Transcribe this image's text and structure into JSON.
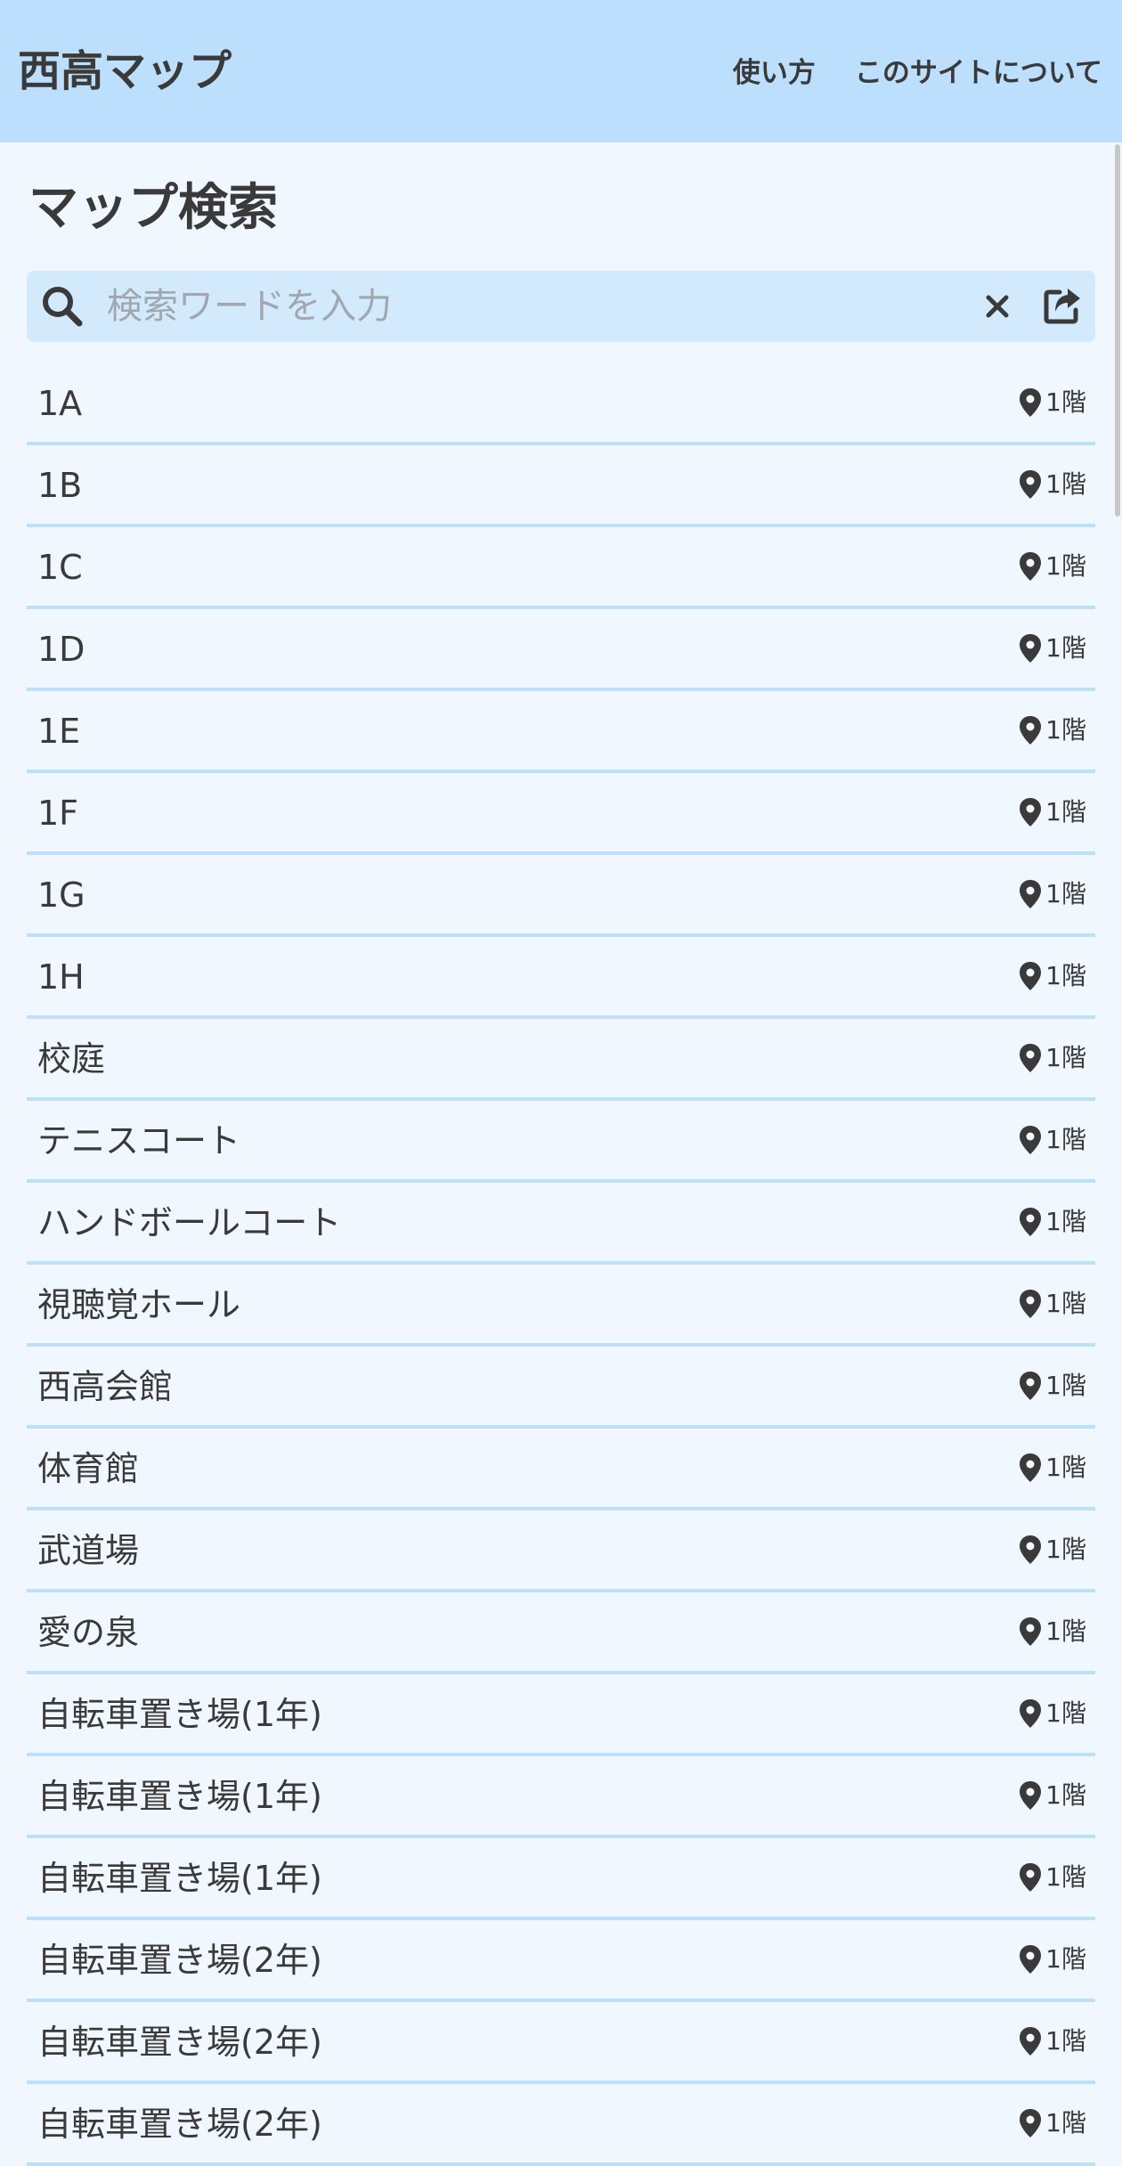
{
  "header": {
    "title": "西高マップ",
    "nav": {
      "usage": "使い方",
      "about": "このサイトについて"
    },
    "background_color": "#bbdffc"
  },
  "main": {
    "title": "マップ検索",
    "search": {
      "placeholder": "検索ワードを入力",
      "value": "",
      "icons": [
        "search-icon",
        "close-icon",
        "share-icon"
      ]
    },
    "items": [
      {
        "name": "1A",
        "floor": "1階"
      },
      {
        "name": "1B",
        "floor": "1階"
      },
      {
        "name": "1C",
        "floor": "1階"
      },
      {
        "name": "1D",
        "floor": "1階"
      },
      {
        "name": "1E",
        "floor": "1階"
      },
      {
        "name": "1F",
        "floor": "1階"
      },
      {
        "name": "1G",
        "floor": "1階"
      },
      {
        "name": "1H",
        "floor": "1階"
      },
      {
        "name": "校庭",
        "floor": "1階"
      },
      {
        "name": "テニスコート",
        "floor": "1階"
      },
      {
        "name": "ハンドボールコート",
        "floor": "1階"
      },
      {
        "name": "視聴覚ホール",
        "floor": "1階"
      },
      {
        "name": "西高会館",
        "floor": "1階"
      },
      {
        "name": "体育館",
        "floor": "1階"
      },
      {
        "name": "武道場",
        "floor": "1階"
      },
      {
        "name": "愛の泉",
        "floor": "1階"
      },
      {
        "name": "自転車置き場(1年)",
        "floor": "1階"
      },
      {
        "name": "自転車置き場(1年)",
        "floor": "1階"
      },
      {
        "name": "自転車置き場(1年)",
        "floor": "1階"
      },
      {
        "name": "自転車置き場(2年)",
        "floor": "1階"
      },
      {
        "name": "自転車置き場(2年)",
        "floor": "1階"
      },
      {
        "name": "自転車置き場(2年)",
        "floor": "1階"
      }
    ]
  },
  "colors": {
    "page_background": "#f1f7fe",
    "search_background": "#d3e9fc",
    "divider": "#bde0f6",
    "text": "#3a3a3a"
  }
}
